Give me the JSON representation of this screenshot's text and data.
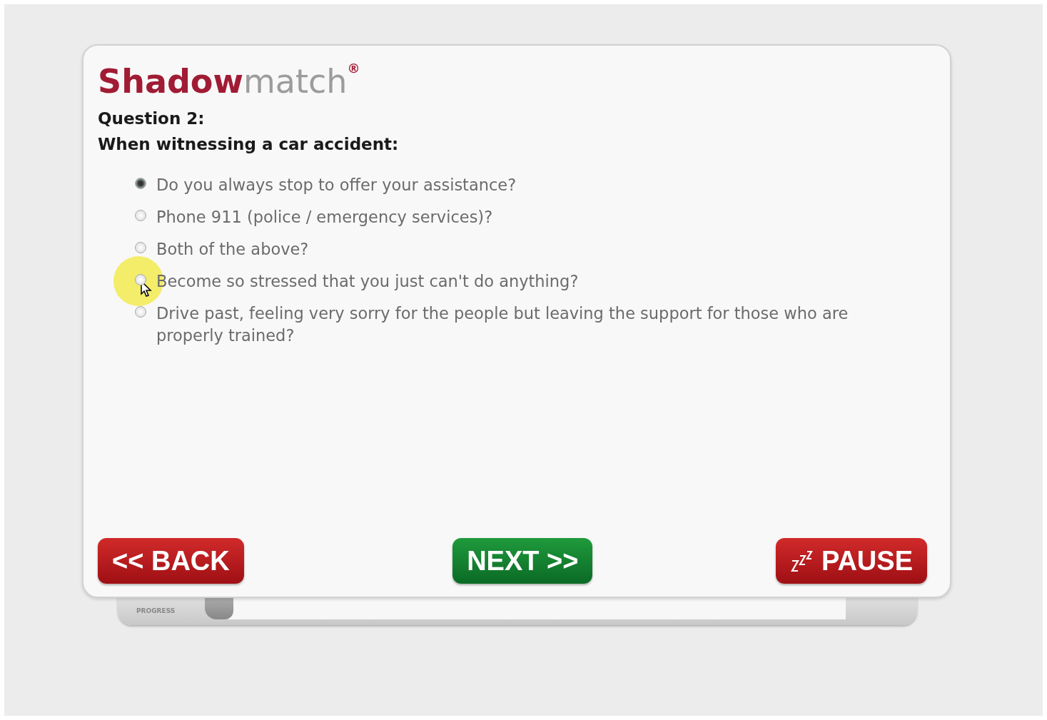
{
  "logo": {
    "primary": "Shadow",
    "secondary": "match",
    "mark": "®"
  },
  "question": {
    "number": "Question 2:",
    "text": "When witnessing a car accident:"
  },
  "options": [
    {
      "label": "Do you always stop to offer your assistance?",
      "selected": true
    },
    {
      "label": "Phone 911 (police / emergency services)?",
      "selected": false
    },
    {
      "label": "Both of the above?",
      "selected": false
    },
    {
      "label": "Become so stressed that you just can't do anything?",
      "selected": false
    },
    {
      "label": "Drive past, feeling very sorry for the people but leaving the support for those who are properly trained?",
      "selected": false
    }
  ],
  "buttons": {
    "back": "<< BACK",
    "next": "NEXT >>",
    "pause": "PAUSE"
  },
  "progress": {
    "label": "PROGRESS",
    "level": 0.0
  }
}
